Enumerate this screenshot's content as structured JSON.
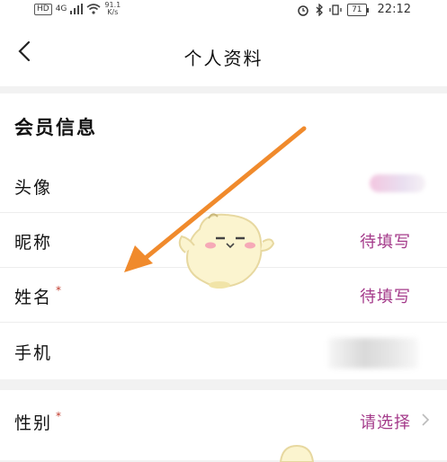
{
  "status_bar": {
    "hd": "HD",
    "network": "4G",
    "speed_value": "91.1",
    "speed_unit": "K/s",
    "battery": "71",
    "time": "22:12"
  },
  "header": {
    "title": "个人资料"
  },
  "member_section": {
    "title": "会员信息",
    "rows": [
      {
        "label": "头像",
        "value": ""
      },
      {
        "label": "昵称",
        "value": "待填写"
      },
      {
        "label": "姓名",
        "required": "*",
        "value": "待填写"
      },
      {
        "label": "手机",
        "value": ""
      }
    ]
  },
  "gender_row": {
    "label": "性别",
    "required": "*",
    "value": "请选择"
  },
  "colors": {
    "value_text": "#a43a8a",
    "arrow": "#f08a2c",
    "required": "#c0392b"
  },
  "icons": [
    "back-arrow-icon",
    "chevron-right-icon",
    "wifi-icon",
    "signal-icon",
    "alarm-icon",
    "bluetooth-icon",
    "vibrate-icon",
    "battery-icon"
  ]
}
